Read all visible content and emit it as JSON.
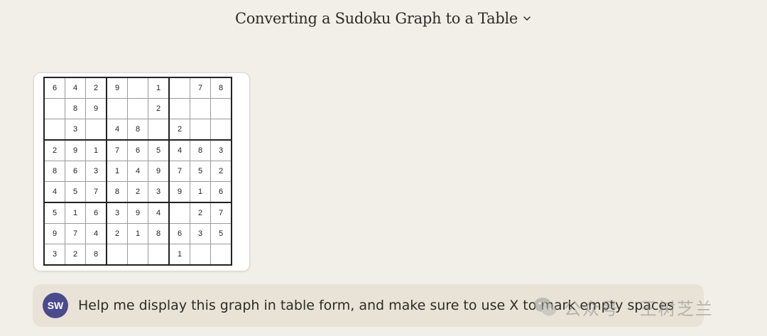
{
  "header": {
    "title": "Converting a Sudoku Graph to a Table",
    "chevron_icon": "chevron-down-icon"
  },
  "attachment": {
    "sudoku": [
      [
        "6",
        "4",
        "2",
        "9",
        "",
        "1",
        "",
        "7",
        "8"
      ],
      [
        "",
        "8",
        "9",
        "",
        "",
        "2",
        "",
        "",
        ""
      ],
      [
        "",
        "3",
        "",
        "4",
        "8",
        "",
        "2",
        "",
        ""
      ],
      [
        "2",
        "9",
        "1",
        "7",
        "6",
        "5",
        "4",
        "8",
        "3"
      ],
      [
        "8",
        "6",
        "3",
        "1",
        "4",
        "9",
        "7",
        "5",
        "2"
      ],
      [
        "4",
        "5",
        "7",
        "8",
        "2",
        "3",
        "9",
        "1",
        "6"
      ],
      [
        "5",
        "1",
        "6",
        "3",
        "9",
        "4",
        "",
        "2",
        "7"
      ],
      [
        "9",
        "7",
        "4",
        "2",
        "1",
        "8",
        "6",
        "3",
        "5"
      ],
      [
        "3",
        "2",
        "8",
        "",
        "",
        "",
        "1",
        "",
        ""
      ]
    ]
  },
  "message": {
    "avatar_initials": "SW",
    "avatar_color": "#4b4a8f",
    "text": "Help me display this graph in table form, and make sure to use X to mark empty spaces"
  },
  "watermark": {
    "text": "公众号 · 王树芝兰",
    "icon": "wechat-icon"
  },
  "colors": {
    "background": "#f2efe8",
    "message_bg": "#e8e3d6"
  }
}
